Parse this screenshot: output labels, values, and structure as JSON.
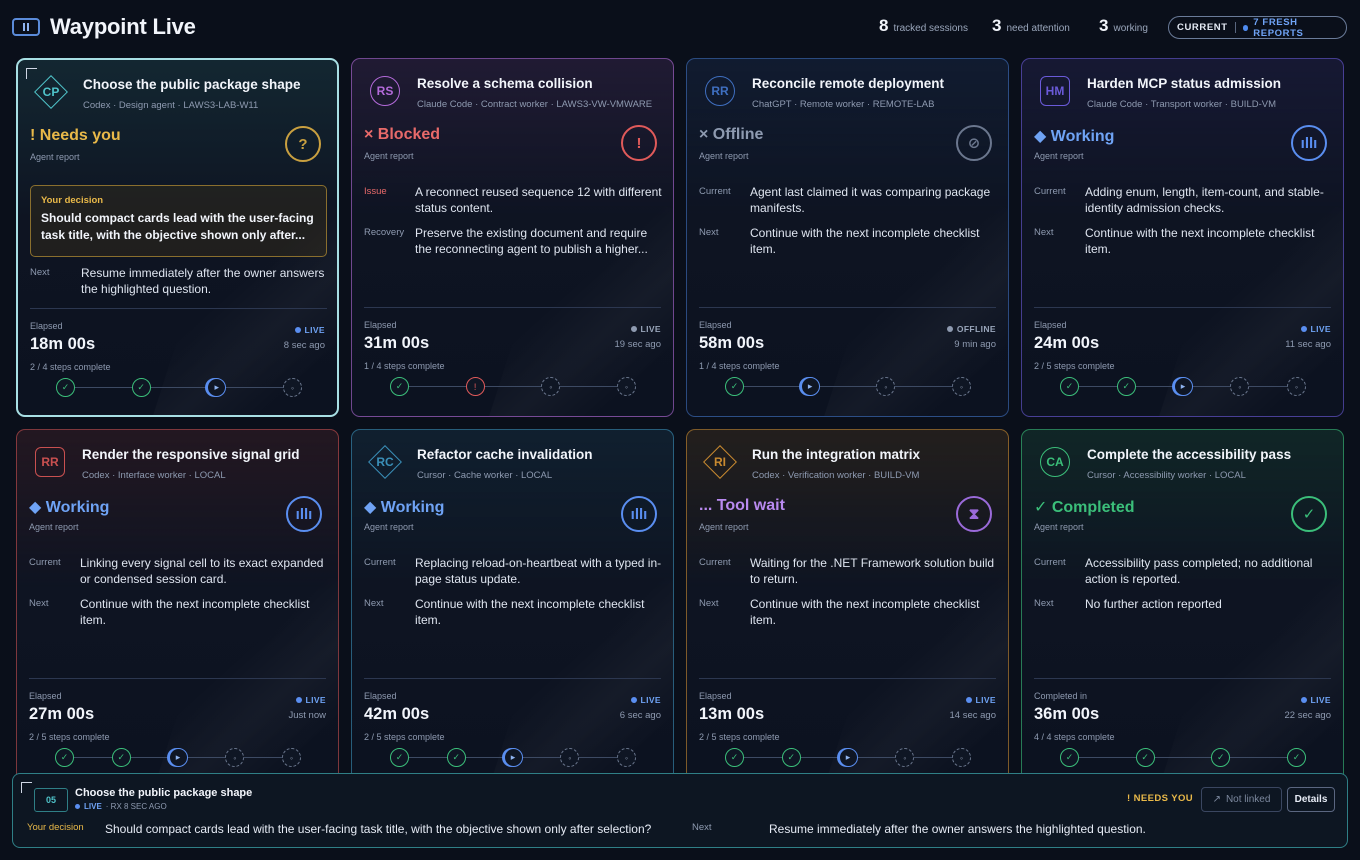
{
  "app": {
    "title": "Waypoint Live"
  },
  "stats": [
    {
      "value": "8",
      "label": "tracked sessions"
    },
    {
      "value": "3",
      "label": "need attention"
    },
    {
      "value": "3",
      "label": "working"
    }
  ],
  "pill": {
    "current": "CURRENT",
    "fresh": "7 FRESH REPORTS"
  },
  "cards": [
    {
      "initials": "CP",
      "title": "Choose the public package shape",
      "sub": "Codex · Design agent · LAWS3-LAB-W11",
      "status": "! Needs you",
      "status_sub": "Agent report",
      "icon": "?",
      "decision_label": "Your decision",
      "decision": "Should compact cards lead with the user-facing task title, with the objective shown only after...",
      "r1_label": "Next",
      "r1": "Resume immediately after the owner answers the highlighted question.",
      "elapsed_label": "Elapsed",
      "elapsed": "18m 00s",
      "live": "LIVE",
      "ago": "8 sec ago",
      "steps": "2 / 4 steps complete",
      "nodes": [
        "done",
        "done",
        "active",
        "todo"
      ],
      "accent": "#4fc3c9"
    },
    {
      "initials": "RS",
      "title": "Resolve a schema collision",
      "sub": "Claude Code · Contract worker · LAWS3-VW-VMWARE",
      "status": "× Blocked",
      "status_sub": "Agent report",
      "icon": "!",
      "r1_label": "Issue",
      "r1": "A reconnect reused sequence 12 with different status content.",
      "r2_label": "Recovery",
      "r2": "Preserve the existing document and require the reconnecting agent to publish a higher...",
      "elapsed_label": "Elapsed",
      "elapsed": "31m 00s",
      "live": "LIVE",
      "ago": "19 sec ago",
      "steps": "1 / 4 steps complete",
      "nodes": [
        "done",
        "err",
        "todo",
        "todo"
      ],
      "accent": "#b36ad9"
    },
    {
      "initials": "RR",
      "title": "Reconcile remote deployment",
      "sub": "ChatGPT · Remote worker · REMOTE-LAB",
      "status": "× Offline",
      "status_sub": "Agent report",
      "icon": "⊘",
      "r1_label": "Current",
      "r1": "Agent last claimed it was comparing package manifests.",
      "r2_label": "Next",
      "r2": "Continue with the next incomplete checklist item.",
      "elapsed_label": "Elapsed",
      "elapsed": "58m 00s",
      "live": "OFFLINE",
      "ago": "9 min ago",
      "steps": "1 / 4 steps complete",
      "nodes": [
        "done",
        "active",
        "todo",
        "todo"
      ],
      "accent": "#3f6fc0"
    },
    {
      "initials": "HM",
      "title": "Harden MCP status admission",
      "sub": "Claude Code · Transport worker · BUILD-VM",
      "status": "◆ Working",
      "status_sub": "Agent report",
      "icon": "ıllı",
      "r1_label": "Current",
      "r1": "Adding enum, length, item-count, and stable-identity admission checks.",
      "r2_label": "Next",
      "r2": "Continue with the next incomplete checklist item.",
      "elapsed_label": "Elapsed",
      "elapsed": "24m 00s",
      "live": "LIVE",
      "ago": "11 sec ago",
      "steps": "2 / 5 steps complete",
      "nodes": [
        "done",
        "done",
        "active",
        "todo",
        "todo"
      ],
      "accent": "#6a5ad9"
    },
    {
      "initials": "RR",
      "title": "Render the responsive signal grid",
      "sub": "Codex · Interface worker · LOCAL",
      "status": "◆ Working",
      "status_sub": "Agent report",
      "icon": "ıllı",
      "r1_label": "Current",
      "r1": "Linking every signal cell to its exact expanded or condensed session card.",
      "r2_label": "Next",
      "r2": "Continue with the next incomplete checklist item.",
      "elapsed_label": "Elapsed",
      "elapsed": "27m 00s",
      "live": "LIVE",
      "ago": "Just now",
      "steps": "2 / 5 steps complete",
      "nodes": [
        "done",
        "done",
        "active",
        "todo",
        "todo"
      ],
      "accent": "#c95050"
    },
    {
      "initials": "RC",
      "title": "Refactor cache invalidation",
      "sub": "Cursor · Cache worker · LOCAL",
      "status": "◆ Working",
      "status_sub": "Agent report",
      "icon": "ıllı",
      "r1_label": "Current",
      "r1": "Replacing reload-on-heartbeat with a typed in-page status update.",
      "r2_label": "Next",
      "r2": "Continue with the next incomplete checklist item.",
      "elapsed_label": "Elapsed",
      "elapsed": "42m 00s",
      "live": "LIVE",
      "ago": "6 sec ago",
      "steps": "2 / 5 steps complete",
      "nodes": [
        "done",
        "done",
        "active",
        "todo",
        "todo"
      ],
      "accent": "#3a8fb8"
    },
    {
      "initials": "RI",
      "title": "Run the integration matrix",
      "sub": "Codex · Verification worker · BUILD-VM",
      "status": "... Tool wait",
      "status_sub": "Agent report",
      "icon": "⧗",
      "r1_label": "Current",
      "r1": "Waiting for the .NET Framework solution build to return.",
      "r2_label": "Next",
      "r2": "Continue with the next incomplete checklist item.",
      "elapsed_label": "Elapsed",
      "elapsed": "13m 00s",
      "live": "LIVE",
      "ago": "14 sec ago",
      "steps": "2 / 5 steps complete",
      "nodes": [
        "done",
        "done",
        "active",
        "todo",
        "todo"
      ],
      "accent": "#c98a30"
    },
    {
      "initials": "CA",
      "title": "Complete the accessibility pass",
      "sub": "Cursor · Accessibility worker · LOCAL",
      "status": "✓ Completed",
      "status_sub": "Agent report",
      "icon": "✓",
      "r1_label": "Current",
      "r1": "Accessibility pass completed; no additional action is reported.",
      "r2_label": "Next",
      "r2": "No further action reported",
      "elapsed_label": "Completed in",
      "elapsed": "36m 00s",
      "live": "LIVE",
      "ago": "22 sec ago",
      "steps": "4 / 4 steps complete",
      "nodes": [
        "done",
        "done",
        "done",
        "done"
      ],
      "accent": "#3bbf7a"
    }
  ],
  "bottom": {
    "badge": "05",
    "title": "Choose the public package shape",
    "live": "LIVE",
    "meta": "· RX 8 SEC AGO",
    "need": "! NEEDS YOU",
    "not_linked": "Not linked",
    "details": "Details",
    "decision_label": "Your decision",
    "decision": "Should compact cards lead with the user-facing task title, with the objective shown only after selection?",
    "next_label": "Next",
    "next": "Resume immediately after the owner answers the highlighted question."
  }
}
